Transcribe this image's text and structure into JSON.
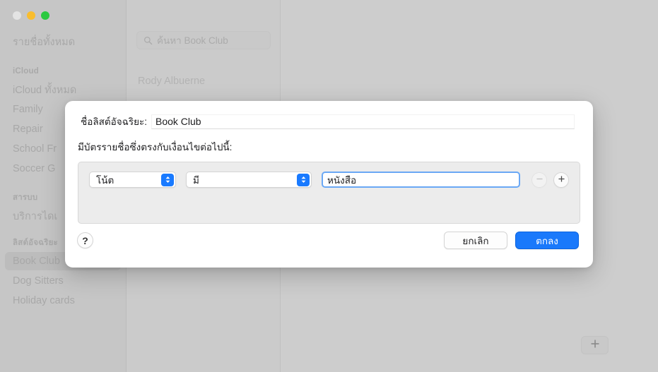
{
  "window": {
    "traffic_lights": [
      "close",
      "minimize",
      "zoom"
    ]
  },
  "sidebar": {
    "all_contacts_label": "รายชื่อทั้งหมด",
    "groups": [
      {
        "type": "header",
        "label": "iCloud"
      },
      {
        "type": "item",
        "label": "iCloud ทั้งหมด"
      },
      {
        "type": "item",
        "label": "Family"
      },
      {
        "type": "item",
        "label": "Repair"
      },
      {
        "type": "item",
        "label": "School Fr"
      },
      {
        "type": "item",
        "label": "Soccer G"
      },
      {
        "type": "header",
        "label": "สารบบ"
      },
      {
        "type": "item",
        "label": "บริการไดเ"
      },
      {
        "type": "header",
        "label": "ลิสต์อัจฉริยะ"
      },
      {
        "type": "item",
        "label": "Book Club",
        "selected": true
      },
      {
        "type": "item",
        "label": "Dog Sitters"
      },
      {
        "type": "item",
        "label": "Holiday cards"
      }
    ]
  },
  "contacts_column": {
    "search": {
      "icon": "search-icon",
      "placeholder": "ค้นหา Book Club",
      "value": ""
    },
    "contacts": [
      {
        "name": "Rody Albuerne"
      }
    ]
  },
  "detail_pane": {
    "add_button_icon": "plus-icon"
  },
  "sheet": {
    "name_label": "ชื่อลิสต์อัจฉริยะ:",
    "name_value": "Book Club",
    "name_placeholder": "",
    "conditions_caption": "มีบัตรรายชื่อซึ่งตรงกับเงื่อนไขต่อไปนี้:",
    "conditions": [
      {
        "criteria": "โน้ต",
        "operator": "มี",
        "value": "หนังสือ",
        "value_placeholder": "",
        "remove_enabled": false,
        "add_enabled": true
      }
    ],
    "help_label": "?",
    "cancel_label": "ยกเลิก",
    "ok_label": "ตกลง"
  },
  "colors": {
    "accent_blue": "#1a79fb",
    "popup_arrow_blue": "#197aff",
    "focus_ring": "#6aa8f5",
    "window_chrome": "#cbcbcb",
    "sidebar": "#c6c6c6",
    "panel": "#ececec",
    "traffic_yellow": "#f9bd2e",
    "traffic_green": "#2bc940"
  }
}
